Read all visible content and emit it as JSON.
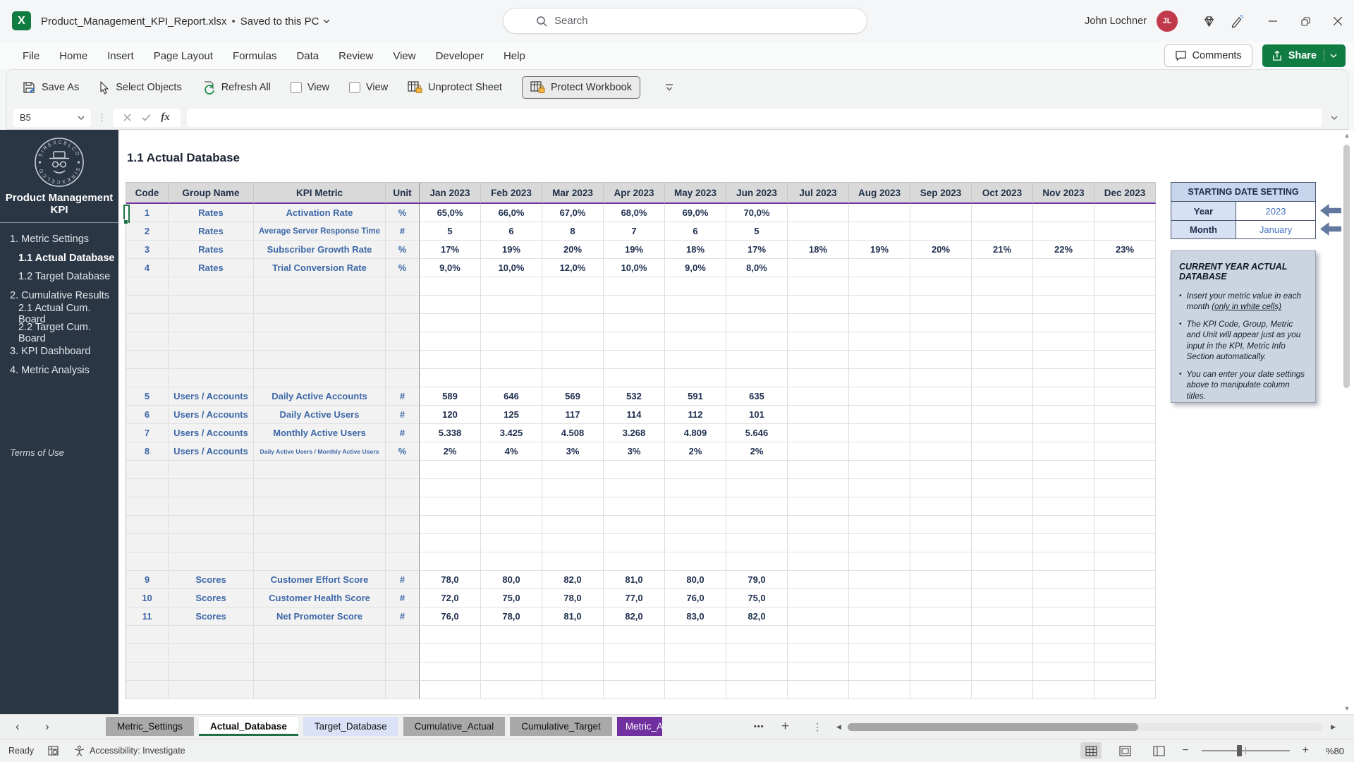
{
  "window": {
    "filename": "Product_Management_KPI_Report.xlsx",
    "saved_status": "Saved to this PC",
    "search_placeholder": "Search",
    "user_name": "John Lochner",
    "user_initials": "JL"
  },
  "ribbon": {
    "tabs": [
      "File",
      "Home",
      "Insert",
      "Page Layout",
      "Formulas",
      "Data",
      "Review",
      "View",
      "Developer",
      "Help"
    ],
    "comments_label": "Comments",
    "share_label": "Share"
  },
  "toolbar": {
    "save_as": "Save As",
    "select_objects": "Select Objects",
    "refresh_all": "Refresh All",
    "view_checkbox_1": "View",
    "view_checkbox_2": "View",
    "unprotect_sheet": "Unprotect Sheet",
    "protect_workbook": "Protect Workbook"
  },
  "formula_bar": {
    "cell_reference": "B5",
    "formula_value": ""
  },
  "sidebar": {
    "logo_text": "SIREXCELCO",
    "title": "Product Management KPI",
    "items": [
      {
        "label": "1. Metric Settings",
        "level": 0,
        "active": false
      },
      {
        "label": "1.1 Actual Database",
        "level": 1,
        "active": true
      },
      {
        "label": "1.2 Target Database",
        "level": 1,
        "active": false
      },
      {
        "label": "2. Cumulative Results",
        "level": 0,
        "active": false
      },
      {
        "label": "2.1 Actual Cum. Board",
        "level": 1,
        "active": false
      },
      {
        "label": "2.2 Target Cum. Board",
        "level": 1,
        "active": false
      },
      {
        "label": "3. KPI Dashboard",
        "level": 0,
        "active": false
      },
      {
        "label": "4. Metric Analysis",
        "level": 0,
        "active": false
      }
    ],
    "footer_link": "Terms of Use"
  },
  "sheet": {
    "section_title": "1.1 Actual Database",
    "table": {
      "fixed_headers": [
        "Code",
        "Group Name",
        "KPI Metric",
        "Unit"
      ],
      "month_headers": [
        "Jan 2023",
        "Feb 2023",
        "Mar 2023",
        "Apr 2023",
        "May 2023",
        "Jun 2023",
        "Jul 2023",
        "Aug 2023",
        "Sep 2023",
        "Oct 2023",
        "Nov 2023",
        "Dec 2023"
      ],
      "row_groups": [
        {
          "rows": [
            {
              "code": "1",
              "group": "Rates",
              "metric": "Activation Rate",
              "unit": "%",
              "values": [
                "65,0%",
                "66,0%",
                "67,0%",
                "68,0%",
                "69,0%",
                "70,0%",
                "",
                "",
                "",
                "",
                "",
                ""
              ]
            },
            {
              "code": "2",
              "group": "Rates",
              "metric": "Average Server Response Time",
              "unit": "#",
              "values": [
                "5",
                "6",
                "8",
                "7",
                "6",
                "5",
                "",
                "",
                "",
                "",
                "",
                ""
              ]
            },
            {
              "code": "3",
              "group": "Rates",
              "metric": "Subscriber Growth Rate",
              "unit": "%",
              "values": [
                "17%",
                "19%",
                "20%",
                "19%",
                "18%",
                "17%",
                "18%",
                "19%",
                "20%",
                "21%",
                "22%",
                "23%"
              ]
            },
            {
              "code": "4",
              "group": "Rates",
              "metric": "Trial Conversion Rate",
              "unit": "%",
              "values": [
                "9,0%",
                "10,0%",
                "12,0%",
                "10,0%",
                "9,0%",
                "8,0%",
                "",
                "",
                "",
                "",
                "",
                ""
              ]
            }
          ],
          "blank_rows_after": 6
        },
        {
          "rows": [
            {
              "code": "5",
              "group": "Users / Accounts",
              "metric": "Daily Active Accounts",
              "unit": "#",
              "values": [
                "589",
                "646",
                "569",
                "532",
                "591",
                "635",
                "",
                "",
                "",
                "",
                "",
                ""
              ]
            },
            {
              "code": "6",
              "group": "Users / Accounts",
              "metric": "Daily Active Users",
              "unit": "#",
              "values": [
                "120",
                "125",
                "117",
                "114",
                "112",
                "101",
                "",
                "",
                "",
                "",
                "",
                ""
              ]
            },
            {
              "code": "7",
              "group": "Users / Accounts",
              "metric": "Monthly Active Users",
              "unit": "#",
              "values": [
                "5.338",
                "3.425",
                "4.508",
                "3.268",
                "4.809",
                "5.646",
                "",
                "",
                "",
                "",
                "",
                ""
              ]
            },
            {
              "code": "8",
              "group": "Users / Accounts",
              "metric": "Daily Active Users / Monthly Active Users",
              "unit": "%",
              "values": [
                "2%",
                "4%",
                "3%",
                "3%",
                "2%",
                "2%",
                "",
                "",
                "",
                "",
                "",
                ""
              ]
            }
          ],
          "blank_rows_after": 6
        },
        {
          "rows": [
            {
              "code": "9",
              "group": "Scores",
              "metric": "Customer Effort Score",
              "unit": "#",
              "values": [
                "78,0",
                "80,0",
                "82,0",
                "81,0",
                "80,0",
                "79,0",
                "",
                "",
                "",
                "",
                "",
                ""
              ]
            },
            {
              "code": "10",
              "group": "Scores",
              "metric": "Customer Health Score",
              "unit": "#",
              "values": [
                "72,0",
                "75,0",
                "78,0",
                "77,0",
                "76,0",
                "75,0",
                "",
                "",
                "",
                "",
                "",
                ""
              ]
            },
            {
              "code": "11",
              "group": "Scores",
              "metric": "Net Promoter Score",
              "unit": "#",
              "values": [
                "76,0",
                "78,0",
                "81,0",
                "82,0",
                "83,0",
                "82,0",
                "",
                "",
                "",
                "",
                "",
                ""
              ]
            }
          ],
          "blank_rows_after": 4
        }
      ]
    },
    "date_setting": {
      "title": "STARTING DATE SETTING",
      "rows": [
        {
          "label": "Year",
          "value": "2023"
        },
        {
          "label": "Month",
          "value": "January"
        }
      ]
    },
    "info_box": {
      "title": "CURRENT YEAR ACTUAL DATABASE",
      "bullets": [
        {
          "text": "Insert your metric value in each month ",
          "underlined": "(only in white cells)"
        },
        {
          "text": "The KPI Code, Group, Metric and Unit will appear just as you input in the KPI, Metric Info Section automatically.",
          "underlined": ""
        },
        {
          "text": "You can enter your date settings above to manipulate column titles.",
          "underlined": ""
        }
      ]
    }
  },
  "sheet_tabs": {
    "tabs": [
      {
        "label": "Metric_Settings",
        "style": "gray",
        "active": false
      },
      {
        "label": "Actual_Database",
        "style": "white",
        "active": true
      },
      {
        "label": "Target_Database",
        "style": "lavender",
        "active": false
      },
      {
        "label": "Cumulative_Actual",
        "style": "gray",
        "active": false
      },
      {
        "label": "Cumulative_Target",
        "style": "gray",
        "active": false
      },
      {
        "label": "Metric_A",
        "style": "purple",
        "active": false
      }
    ]
  },
  "status_bar": {
    "mode": "Ready",
    "accessibility": "Accessibility: Investigate",
    "zoom_level": "%80"
  },
  "colors": {
    "excel_green": "#107c41",
    "active_sheet_underline": "#1e7145",
    "header_purple": "#7030a0",
    "sidebar_bg": "#2b3645",
    "table_blue_text": "#3e68a8",
    "table_value_text": "#1d2d4d",
    "avatar_red": "#c13a4b",
    "purple_tab": "#7030a0"
  }
}
